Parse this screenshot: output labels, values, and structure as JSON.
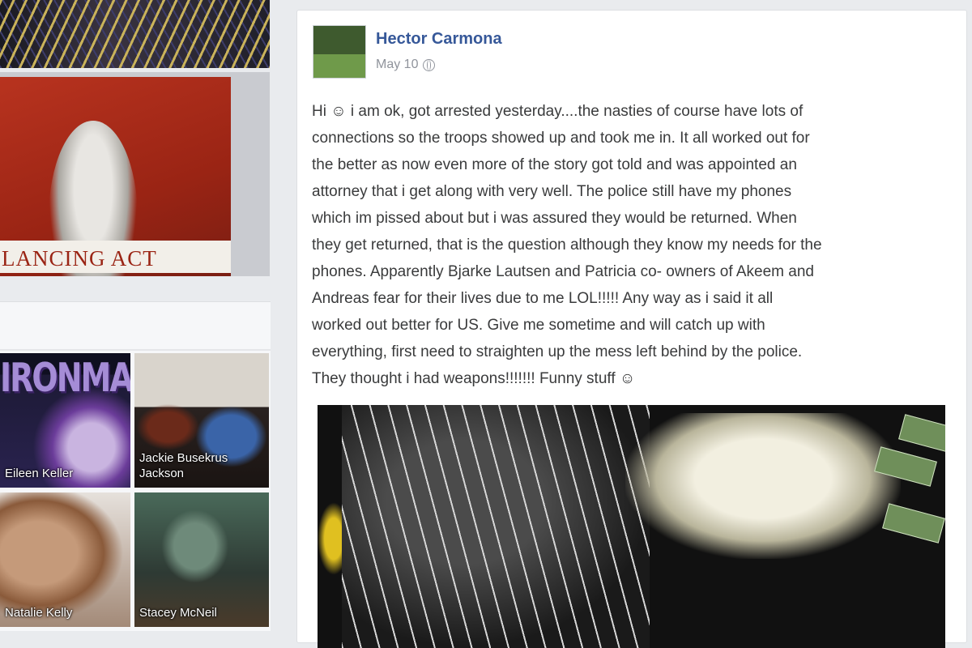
{
  "left_column": {
    "book_cover_text": "LANCING ACT",
    "friend_logo_text": "IRONMARE",
    "friends": [
      {
        "name": "Eileen Keller"
      },
      {
        "name": "Jackie Busekrus Jackson"
      },
      {
        "name": "Natalie Kelly"
      },
      {
        "name": "Stacey McNeil"
      }
    ]
  },
  "post": {
    "author": "Hector Carmona",
    "date": "May 10",
    "privacy_icon": "globe-icon",
    "text_lines": [
      "Hi ☺ i am ok, got arrested yesterday....the nasties of course have lots of",
      "connections so the troops showed up and took me in. It all worked out for",
      "the better as now even more of the story got told and was appointed an",
      "attorney that i get along with very well. The police still have my phones",
      "which im pissed about but i was assured they would be returned. When",
      "they get returned, that is the question although they know my needs for the",
      "phones. Apparently Bjarke Lautsen and Patricia co- owners of Akeem and",
      "Andreas fear for their lives due to me LOL!!!!! Any way as i said it all",
      "worked out better for US. Give me sometime and will catch up with",
      "everything, first need to straighten up the mess left behind by the police.",
      "They thought i had weapons!!!!!!! Funny stuff ☺"
    ]
  }
}
